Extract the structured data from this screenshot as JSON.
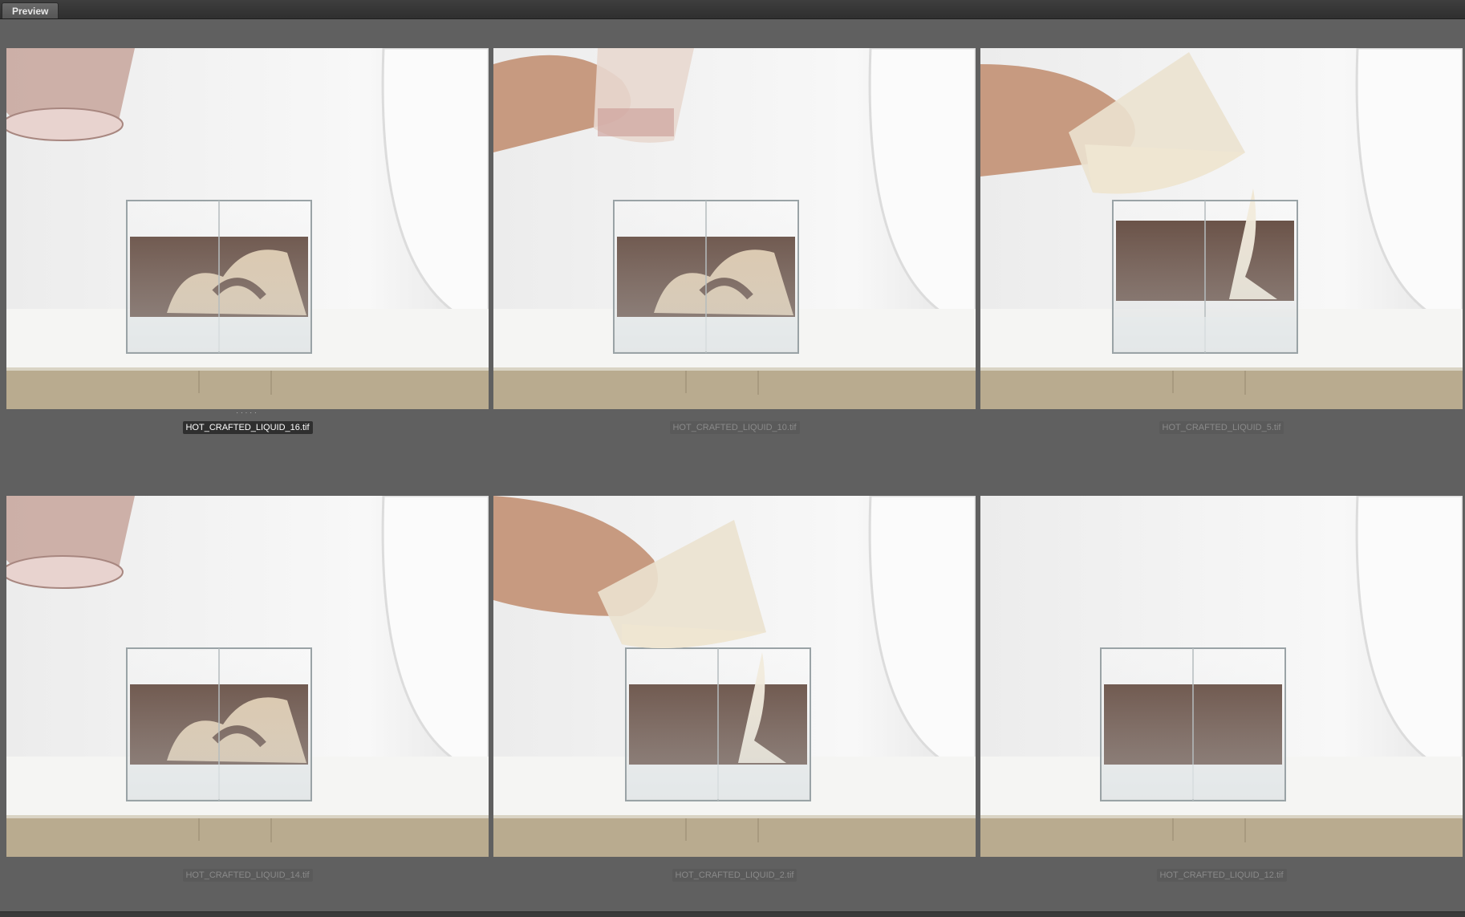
{
  "window": {
    "tab_label": "Preview"
  },
  "colors": {
    "panel_bg": "#606060",
    "caption_selected_bg": "#2f2f2f",
    "coffee": "#3a1a0c",
    "cream": "#d9bf9a",
    "milk": "#efe6d2"
  },
  "thumbnails": [
    {
      "filename": "HOT_CRAFTED_LIQUID_16.tif",
      "selected": true,
      "scene": "mixed-cup-above"
    },
    {
      "filename": "HOT_CRAFTED_LIQUID_10.tif",
      "selected": false,
      "scene": "mixed-hand-holding"
    },
    {
      "filename": "HOT_CRAFTED_LIQUID_5.tif",
      "selected": false,
      "scene": "pouring-right"
    },
    {
      "filename": "HOT_CRAFTED_LIQUID_14.tif",
      "selected": false,
      "scene": "mixed-cup-above"
    },
    {
      "filename": "HOT_CRAFTED_LIQUID_2.tif",
      "selected": false,
      "scene": "pouring-center"
    },
    {
      "filename": "HOT_CRAFTED_LIQUID_12.tif",
      "selected": false,
      "scene": "black-coffee"
    }
  ]
}
